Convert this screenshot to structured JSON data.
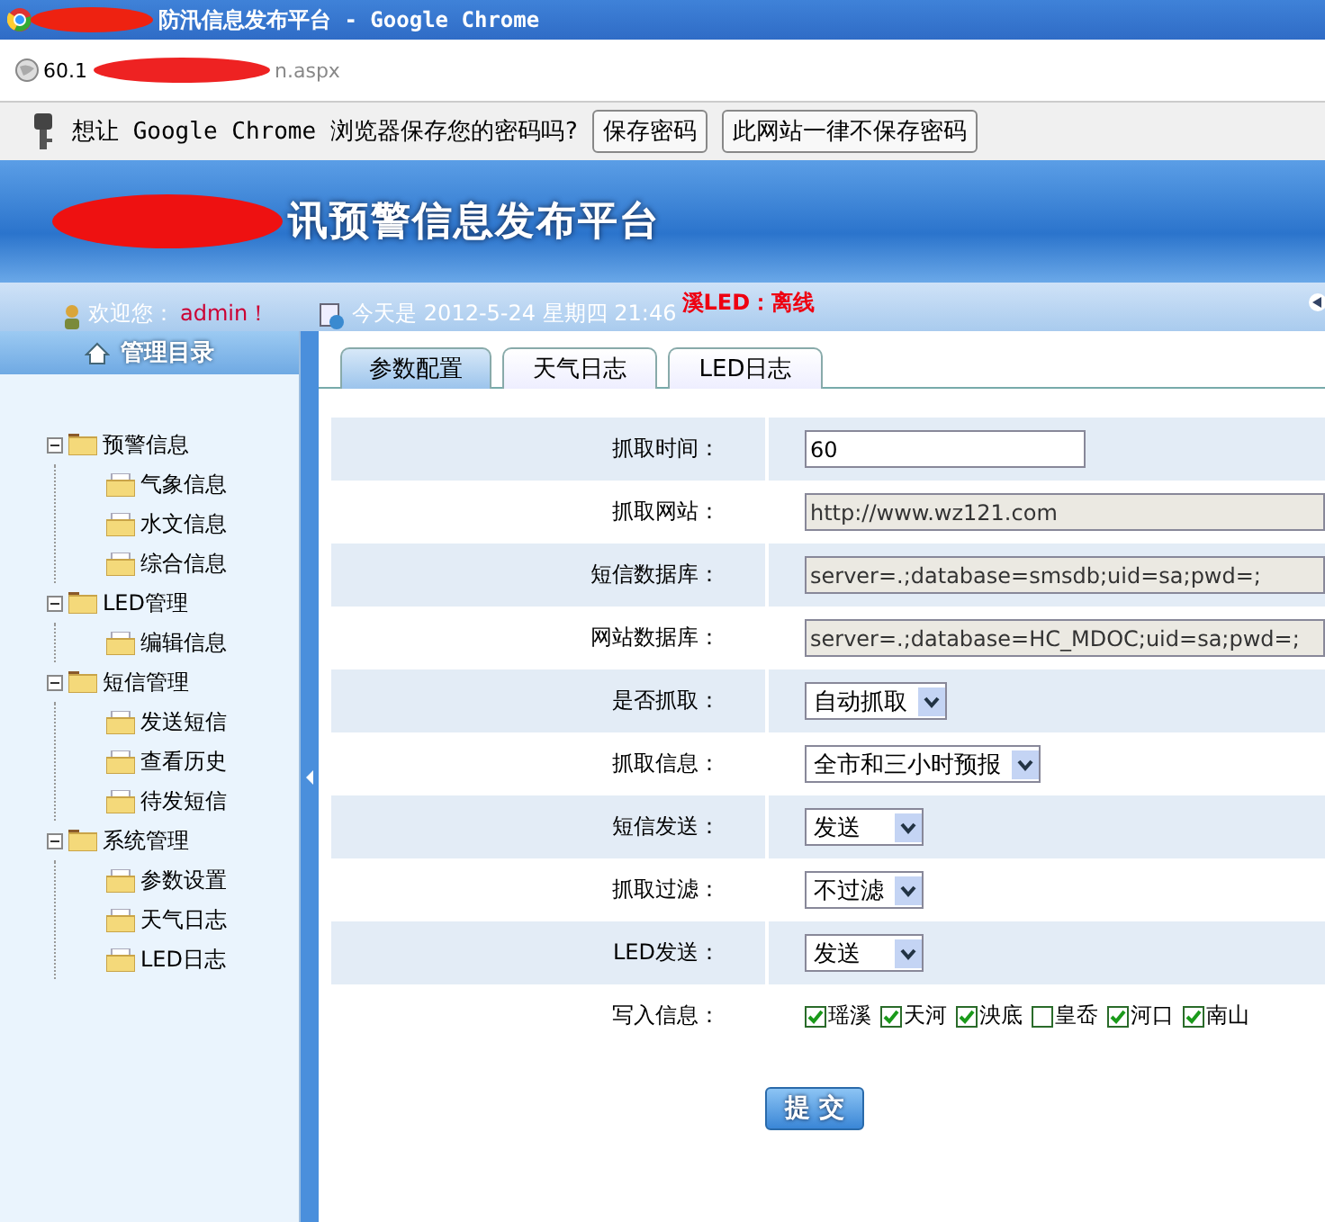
{
  "window": {
    "title": "防汛信息发布平台 - Google Chrome"
  },
  "address_bar": {
    "start": "60.1",
    "end": "n.aspx"
  },
  "password_bar": {
    "message": "想让 Google Chrome 浏览器保存您的密码吗?",
    "buttons": [
      "保存密码",
      "此网站一律不保存密码"
    ]
  },
  "header": {
    "title": "讯预警信息发布平台"
  },
  "status_bar": {
    "welcome": "欢迎您：",
    "user": "admin！",
    "date": "今天是 2012-5-24 星期四 21:46",
    "led_status": "溪LED：离线"
  },
  "sidebar": {
    "title": "管理目录",
    "items": [
      {
        "label": "预警信息",
        "expanded": true,
        "children": [
          {
            "label": "气象信息"
          },
          {
            "label": "水文信息"
          },
          {
            "label": "综合信息"
          }
        ]
      },
      {
        "label": "LED管理",
        "expanded": true,
        "children": [
          {
            "label": "编辑信息"
          }
        ]
      },
      {
        "label": "短信管理",
        "expanded": true,
        "children": [
          {
            "label": "发送短信"
          },
          {
            "label": "查看历史"
          },
          {
            "label": "待发短信"
          }
        ]
      },
      {
        "label": "系统管理",
        "expanded": true,
        "children": [
          {
            "label": "参数设置"
          },
          {
            "label": "天气日志"
          },
          {
            "label": "LED日志"
          }
        ]
      }
    ]
  },
  "tabs": [
    {
      "label": "参数配置",
      "selected": true
    },
    {
      "label": "天气日志",
      "selected": false
    },
    {
      "label": "LED日志",
      "selected": false
    }
  ],
  "form": {
    "rows": [
      {
        "label": "抓取时间：",
        "kind": "input",
        "value": "60",
        "disabled": false
      },
      {
        "label": "抓取网站：",
        "kind": "input",
        "value": "http://www.wz121.com",
        "disabled": true
      },
      {
        "label": "短信数据库：",
        "kind": "input",
        "value": "server=.;database=smsdb;uid=sa;pwd=;",
        "disabled": true
      },
      {
        "label": "网站数据库：",
        "kind": "input",
        "value": "server=.;database=HC_MDOC;uid=sa;pwd=;",
        "disabled": true
      },
      {
        "label": "是否抓取：",
        "kind": "select",
        "value": "自动抓取"
      },
      {
        "label": "抓取信息：",
        "kind": "select",
        "value": "全市和三小时预报"
      },
      {
        "label": "短信发送：",
        "kind": "select",
        "value": "发送"
      },
      {
        "label": "抓取过滤：",
        "kind": "select",
        "value": "不过滤"
      },
      {
        "label": "LED发送：",
        "kind": "select",
        "value": "发送"
      },
      {
        "label": "写入信息：",
        "kind": "checks",
        "options": [
          {
            "label": "瑶溪",
            "checked": true
          },
          {
            "label": "天河",
            "checked": true
          },
          {
            "label": "泱底",
            "checked": true
          },
          {
            "label": "皇岙",
            "checked": false
          },
          {
            "label": "河口",
            "checked": true
          },
          {
            "label": "南山",
            "checked": true
          }
        ]
      }
    ],
    "submit": "提 交"
  }
}
